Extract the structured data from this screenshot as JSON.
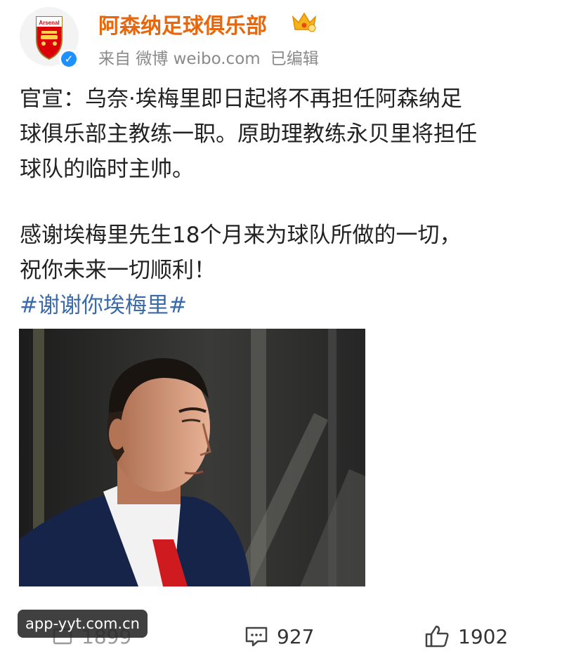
{
  "post": {
    "author": {
      "name": "阿森纳足球俱乐部",
      "avatar_icon": "arsenal-crest",
      "avatar_text": "Arsenal",
      "verified_badge_icon": "verified-check-icon",
      "vip_icon": "crown-icon"
    },
    "meta": {
      "source": "来自 微博 weibo.com",
      "edited": "已编辑"
    },
    "lines": [
      "官宣：乌奈·埃梅里即日起将不再担任阿森纳足",
      "球俱乐部主教练一职。原助理教练永贝里将担任",
      "球队的临时主帅。",
      "感谢埃梅里先生18个月来为球队所做的一切，",
      "祝你未来一切顺利！"
    ],
    "hashtag": "#谢谢你埃梅里#",
    "image_alt": "photo of a man in a navy suit with a red tie"
  },
  "actions": {
    "repost_count": "1899",
    "comment_count": "927",
    "like_count": "1902"
  },
  "watermark": "app-yyt.com.cn",
  "colors": {
    "name": "#e8660c",
    "hashtag": "#3b6aa8",
    "meta": "#8a8a8a",
    "verified": "#1e90ff"
  }
}
